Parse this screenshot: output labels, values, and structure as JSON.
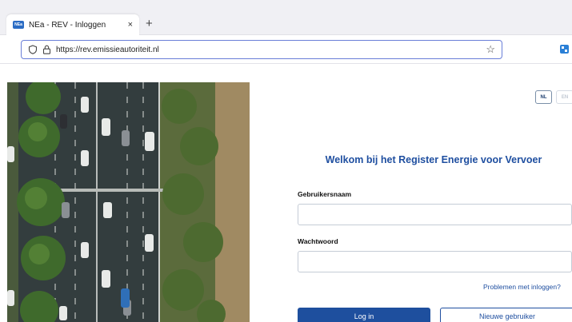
{
  "browser": {
    "tab": {
      "title": "NEa - REV - Inloggen",
      "close_glyph": "×",
      "favicon": "nea-favicon"
    },
    "new_tab_glyph": "+",
    "address_bar": {
      "url": "https://rev.emissieautoriteit.nl",
      "bookmark_glyph": "☆"
    },
    "extension_icon": "extension-icon"
  },
  "aerial": {
    "description_icon": "aerial-photo"
  },
  "login": {
    "languages": [
      "NL",
      "EN"
    ],
    "heading": "Welkom bij het Register Energie voor Vervoer",
    "username_label": "Gebruikersnaam",
    "username_value": "",
    "password_label": "Wachtwoord",
    "password_value": "",
    "problems_link": "Problemen met inloggen?",
    "login_button": "Log in",
    "new_user_button": "Nieuwe gebruiker"
  },
  "colors": {
    "accent": "#1f4fa0",
    "button_primary": "#1e4f9e"
  }
}
